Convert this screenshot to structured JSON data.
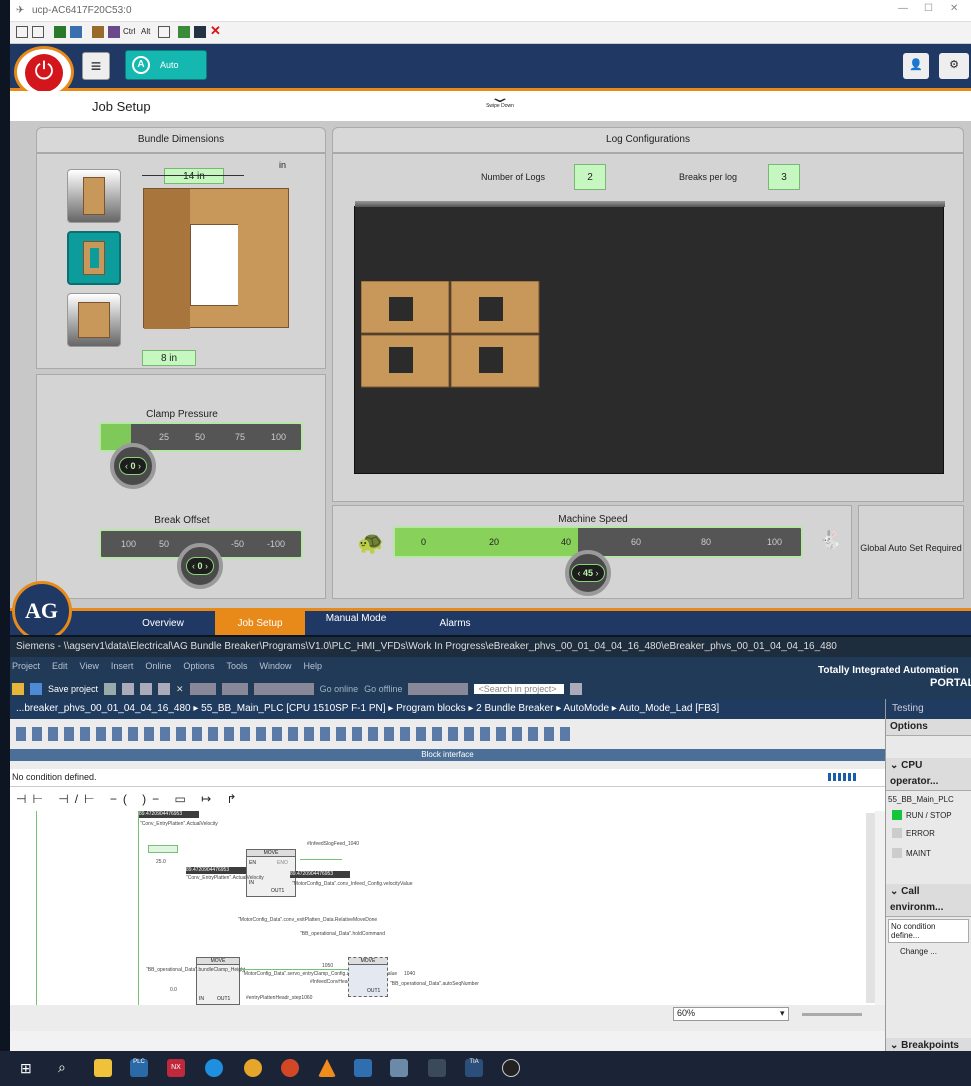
{
  "hmi": {
    "window_title": "ucp-AC6417F20C53:0",
    "mode_button": "Auto",
    "swipe_hint": "Swipe Down",
    "page_title": "Job Setup",
    "bundle": {
      "heading": "Bundle Dimensions",
      "unit": "in",
      "top_dim": "14 in",
      "bottom_dim": "8 in"
    },
    "logs": {
      "heading": "Log Configurations",
      "num_logs_label": "Number of Logs",
      "num_logs": "2",
      "breaks_label": "Breaks per log",
      "breaks": "3"
    },
    "clamp": {
      "label": "Clamp Pressure",
      "ticks": [
        "25",
        "50",
        "75",
        "100"
      ],
      "knob_value": "0"
    },
    "break_offset": {
      "label": "Break Offset",
      "ticks": [
        "100",
        "50",
        "-50",
        "-100"
      ],
      "knob_value": "0"
    },
    "machine_speed": {
      "label": "Machine Speed",
      "ticks": [
        "0",
        "20",
        "40",
        "60",
        "80",
        "100"
      ],
      "knob_value": "45",
      "level": 0.45
    },
    "global_auto": "Global Auto Set Required",
    "nav": [
      "Overview",
      "Job Setup",
      "Manual Mode",
      "Alarms"
    ],
    "active_nav": "Job Setup",
    "colors": {
      "accent_orange": "#e88a1a",
      "navy": "#1f3864",
      "wood": "#c8975a",
      "green": "#b7e6a7"
    }
  },
  "tia": {
    "title": "Siemens - \\\\agserv1\\data\\Electrical\\AG Bundle Breaker\\Programs\\V1.0\\PLC_HMI_VFDs\\Work In Progress\\eBreaker_phvs_00_01_04_04_16_480\\eBreaker_phvs_00_01_04_04_16_480",
    "menu": [
      "Project",
      "Edit",
      "View",
      "Insert",
      "Online",
      "Options",
      "Tools",
      "Window",
      "Help"
    ],
    "save_project": "Save project",
    "go_online": "Go online",
    "go_offline": "Go offline",
    "search_placeholder": "<Search in project>",
    "brand_line1": "Totally Integrated Automation",
    "brand_line2": "PORTAL",
    "breadcrumb": "...breaker_phvs_00_01_04_04_16_480 ▸ 55_BB_Main_PLC [CPU 1510SP F-1 PN] ▸ Program blocks ▸ 2 Bundle Breaker ▸ AutoMode ▸ Auto_Mode_Lad [FB3]",
    "block_interface": "Block interface",
    "no_condition": "No condition defined.",
    "zoom": "60%",
    "right_panel": {
      "testing": "Testing",
      "options": "Options",
      "cpu_operator": "CPU operator...",
      "plc_name": "55_BB_Main_PLC",
      "run_stop": "RUN / STOP",
      "error": "ERROR",
      "maint": "MAINT",
      "call_env": "Call environm...",
      "no_condition": "No condition define...",
      "change": "Change ...",
      "breakpoints": "Breakpoints"
    },
    "ladder": {
      "tag1": "89.4720904476953",
      "move": "MOVE",
      "en": "EN",
      "eno": "ENO",
      "in": "IN",
      "out1": "OUT1",
      "n1": "\"Conv_EntryPlatten\".ActualVelocity",
      "n2": "#InfeedSlogFeed_1040",
      "n3": "\"MotorConfig_Data\".conv_Infeed_Config.velocityValue",
      "n4": "\"MotorConfig_Data\".conv_exitPlatten_Data.RelativeMoveDone",
      "n5": "\"BB_operational_Data\".holdCommand",
      "n6": "#InfeedConvHeadr_step1050",
      "n7": "#entryPlattenHeadr_step1060",
      "n8": "\"BB_operational_Data\".bundleClamp_Height",
      "n9": "1040",
      "n10": "\"BB_operational_Data\".autoSeqNumber",
      "n11": "\"MotorConfig_Data\".servo_entryClamp_Config.absolutePosition/Value",
      "v1": "25.0",
      "v2": "0.0",
      "v3": "1050"
    }
  },
  "taskbar": [
    "start-icon",
    "search-icon",
    "files-icon",
    "plcsim-icon",
    "nx-icon",
    "edge-icon",
    "chrome-icon",
    "powerpoint-icon",
    "vlc-icon",
    "app-icon",
    "app2-icon",
    "tool-icon",
    "tia-icon",
    "github-icon"
  ]
}
